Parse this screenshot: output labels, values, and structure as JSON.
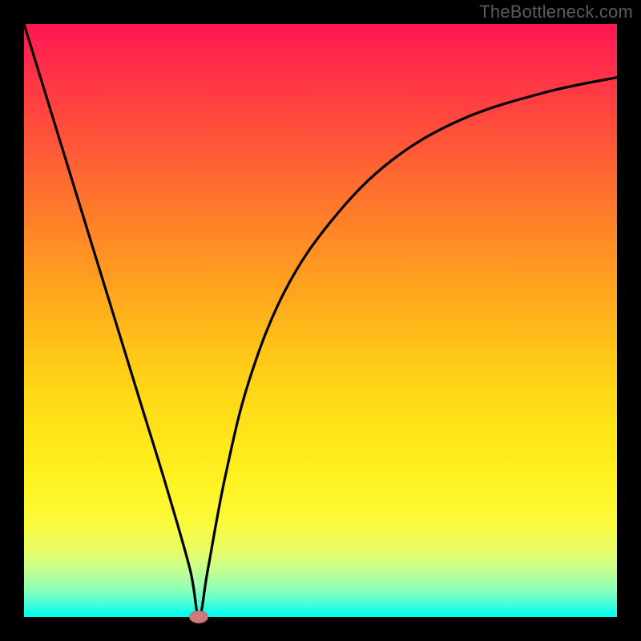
{
  "watermark": "TheBottleneck.com",
  "chart_data": {
    "type": "line",
    "title": "",
    "xlabel": "",
    "ylabel": "",
    "xlim": [
      0,
      100
    ],
    "ylim": [
      0,
      100
    ],
    "grid": false,
    "background_gradient": {
      "direction": "vertical",
      "stops": [
        {
          "pos": 0,
          "color": "#ff1552"
        },
        {
          "pos": 0.5,
          "color": "#ffb41a"
        },
        {
          "pos": 0.8,
          "color": "#fff323"
        },
        {
          "pos": 1.0,
          "color": "#00ffec"
        }
      ]
    },
    "series": [
      {
        "name": "bottleneck-curve",
        "color": "#000000",
        "x": [
          0,
          4,
          8,
          12,
          16,
          20,
          24,
          28,
          29.5,
          31,
          34,
          38,
          44,
          52,
          62,
          74,
          88,
          100
        ],
        "y": [
          100,
          87,
          74,
          61,
          48,
          35,
          22,
          8,
          0,
          8,
          24,
          40,
          55,
          67,
          77,
          84,
          88.5,
          91
        ]
      }
    ],
    "marker": {
      "name": "min-point",
      "x": 29.5,
      "y": 0,
      "color": "#cc7b79"
    }
  }
}
